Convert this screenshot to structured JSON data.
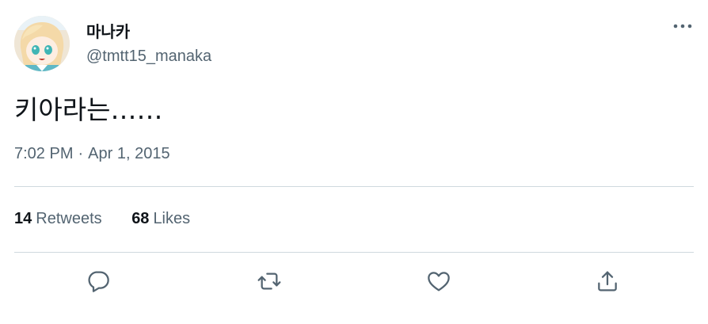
{
  "author": {
    "display_name": "마나카",
    "handle": "@tmtt15_manaka",
    "avatar_icon": "avatar-image"
  },
  "tweet": {
    "text": "키아라는……",
    "time": "7:02 PM",
    "separator": "·",
    "date": "Apr 1, 2015"
  },
  "stats": {
    "retweets_count": "14",
    "retweets_label": "Retweets",
    "likes_count": "68",
    "likes_label": "Likes"
  },
  "actions": {
    "reply_icon": "reply-icon",
    "retweet_icon": "retweet-icon",
    "like_icon": "heart-icon",
    "share_icon": "share-icon",
    "more_icon": "more-options-icon"
  },
  "colors": {
    "primary_text": "#0f1419",
    "secondary_text": "#536471",
    "divider": "#cfd9de"
  }
}
